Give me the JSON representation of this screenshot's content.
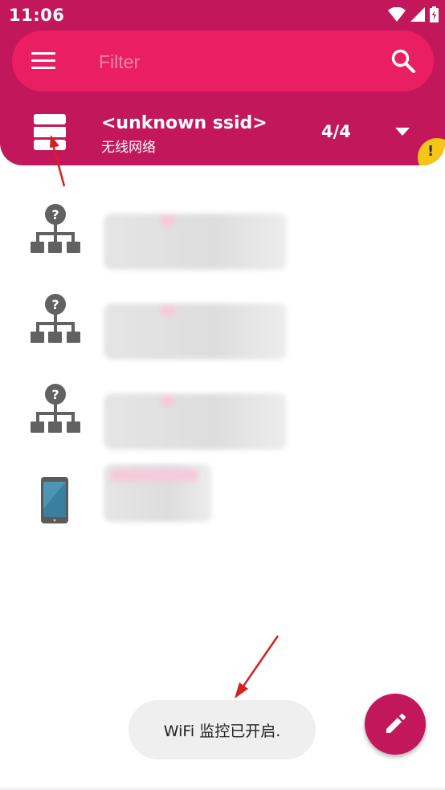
{
  "status_bar": {
    "time": "11:06"
  },
  "search": {
    "placeholder": "Filter",
    "value": ""
  },
  "network": {
    "ssid": "<unknown ssid>",
    "subtitle": "无线网络",
    "count": "4/4"
  },
  "devices": [
    {
      "type": "unknown-host"
    },
    {
      "type": "unknown-host"
    },
    {
      "type": "unknown-host"
    },
    {
      "type": "phone"
    }
  ],
  "toast": {
    "message": "WiFi 监控已开启."
  },
  "colors": {
    "primary": "#c2185b",
    "search_bar": "#e91e63",
    "warning": "#f5c518",
    "icon_gray": "#616161"
  },
  "icons": {
    "menu": "menu-icon",
    "search": "search-icon",
    "network": "network-list-icon",
    "dropdown": "chevron-down-icon",
    "warning": "warning-icon",
    "edit": "edit-icon"
  }
}
